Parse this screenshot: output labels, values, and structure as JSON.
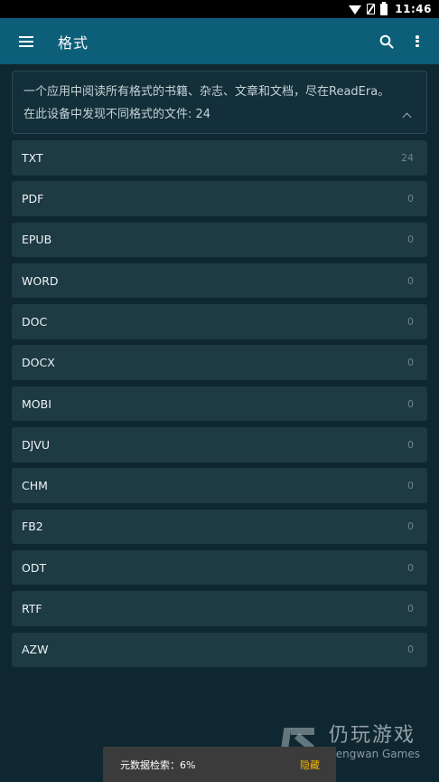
{
  "status_bar": {
    "time": "11:46"
  },
  "app_bar": {
    "title": "格式"
  },
  "info": {
    "description": "一个应用中阅读所有格式的书籍、杂志、文章和文档，尽在ReadEra。",
    "found_label": "在此设备中发现不同格式的文件: 24"
  },
  "formats": [
    {
      "name": "TXT",
      "count": "24"
    },
    {
      "name": "PDF",
      "count": "0"
    },
    {
      "name": "EPUB",
      "count": "0"
    },
    {
      "name": "WORD",
      "count": "0"
    },
    {
      "name": "DOC",
      "count": "0"
    },
    {
      "name": "DOCX",
      "count": "0"
    },
    {
      "name": "MOBI",
      "count": "0"
    },
    {
      "name": "DJVU",
      "count": "0"
    },
    {
      "name": "CHM",
      "count": "0"
    },
    {
      "name": "FB2",
      "count": "0"
    },
    {
      "name": "ODT",
      "count": "0"
    },
    {
      "name": "RTF",
      "count": "0"
    },
    {
      "name": "AZW",
      "count": "0"
    }
  ],
  "watermark": {
    "cn": "仍玩游戏",
    "en": "Rengwan Games"
  },
  "snackbar": {
    "message": "元数据检索：6%",
    "action": "隐藏"
  },
  "colors": {
    "app_bar": "#0d5f79",
    "background": "#0f2730",
    "row": "#1e3a43",
    "snack_action": "#f5b800"
  },
  "icons": {
    "menu": "hamburger-menu-icon",
    "search": "search-icon",
    "more": "more-vertical-icon",
    "collapse": "chevron-up-icon"
  }
}
